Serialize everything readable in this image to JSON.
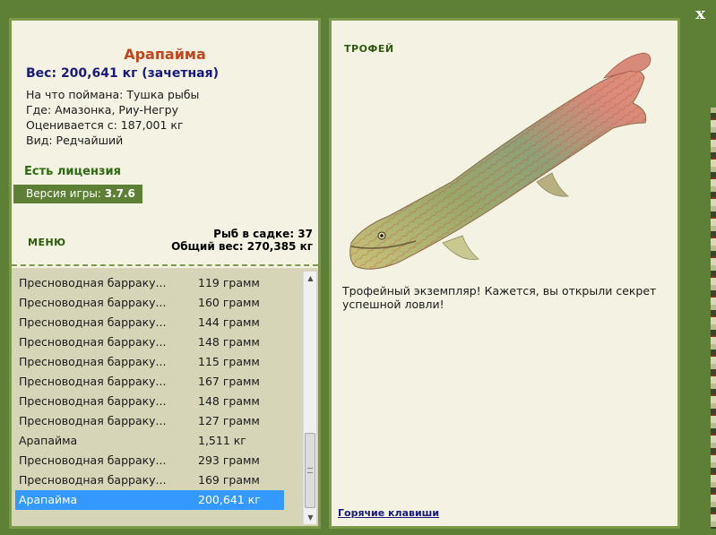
{
  "window": {
    "close_label": "x"
  },
  "info": {
    "fish_name": "Арапайма",
    "weight_line": "Вес: 200,641 кг (зачетная)",
    "caught_on": "На что поймана: Тушка рыбы",
    "location": "Где: Амазонка, Риу-Негру",
    "valued_from": "Оценивается с: 187,001 кг",
    "rarity": "Вид: Редчайший",
    "license": "Есть лицензия",
    "version_label": "Версия игры: ",
    "version_value": "3.7.6"
  },
  "menu": {
    "label": "МЕНЮ"
  },
  "stats": {
    "fish_in_keepnet": "Рыб в садке: 37",
    "total_weight": "Общий вес: 270,385 кг"
  },
  "catches": [
    {
      "name": "Пресноводная барраку...",
      "weight": "119 грамм"
    },
    {
      "name": "Пресноводная барраку...",
      "weight": "160 грамм"
    },
    {
      "name": "Пресноводная барраку...",
      "weight": "144 грамм"
    },
    {
      "name": "Пресноводная барраку...",
      "weight": "148 грамм"
    },
    {
      "name": "Пресноводная барраку...",
      "weight": "115 грамм"
    },
    {
      "name": "Пресноводная барраку...",
      "weight": "167 грамм"
    },
    {
      "name": "Пресноводная барраку...",
      "weight": "148 грамм"
    },
    {
      "name": "Пресноводная барраку...",
      "weight": "127 грамм"
    },
    {
      "name": "Арапайма",
      "weight": "1,511 кг"
    },
    {
      "name": "Пресноводная барраку...",
      "weight": "293 грамм"
    },
    {
      "name": "Пресноводная барраку...",
      "weight": "169 грамм"
    },
    {
      "name": "Арапайма",
      "weight": "200,641 кг"
    }
  ],
  "selected_catch_index": 11,
  "trophy": {
    "label": "ТРОФЕЙ",
    "message": "Трофейный экземпляр! Кажется, вы открыли секрет успешной ловли!",
    "hotkeys_link": "Горячие клавиши"
  },
  "colors": {
    "frame_green": "#5e7f36",
    "panel_bg": "#f4f2e2",
    "list_bg": "#d7d5b7",
    "fish_name": "#c0461e",
    "weight": "#1a1a7a",
    "license": "#2e6a10",
    "selection": "#3399ff"
  }
}
